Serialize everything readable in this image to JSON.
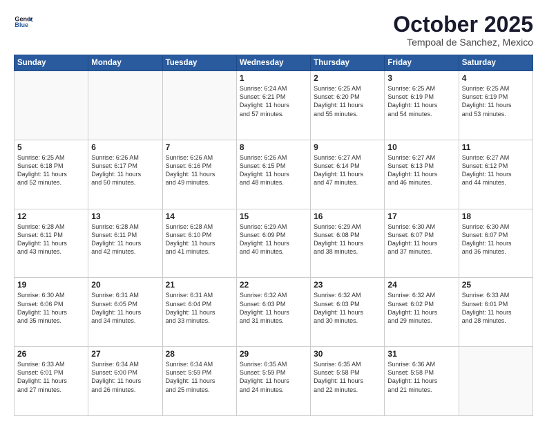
{
  "logo": {
    "line1": "General",
    "line2": "Blue"
  },
  "title": "October 2025",
  "subtitle": "Tempoal de Sanchez, Mexico",
  "weekdays": [
    "Sunday",
    "Monday",
    "Tuesday",
    "Wednesday",
    "Thursday",
    "Friday",
    "Saturday"
  ],
  "weeks": [
    [
      {
        "day": "",
        "info": ""
      },
      {
        "day": "",
        "info": ""
      },
      {
        "day": "",
        "info": ""
      },
      {
        "day": "1",
        "info": "Sunrise: 6:24 AM\nSunset: 6:21 PM\nDaylight: 11 hours\nand 57 minutes."
      },
      {
        "day": "2",
        "info": "Sunrise: 6:25 AM\nSunset: 6:20 PM\nDaylight: 11 hours\nand 55 minutes."
      },
      {
        "day": "3",
        "info": "Sunrise: 6:25 AM\nSunset: 6:19 PM\nDaylight: 11 hours\nand 54 minutes."
      },
      {
        "day": "4",
        "info": "Sunrise: 6:25 AM\nSunset: 6:19 PM\nDaylight: 11 hours\nand 53 minutes."
      }
    ],
    [
      {
        "day": "5",
        "info": "Sunrise: 6:25 AM\nSunset: 6:18 PM\nDaylight: 11 hours\nand 52 minutes."
      },
      {
        "day": "6",
        "info": "Sunrise: 6:26 AM\nSunset: 6:17 PM\nDaylight: 11 hours\nand 50 minutes."
      },
      {
        "day": "7",
        "info": "Sunrise: 6:26 AM\nSunset: 6:16 PM\nDaylight: 11 hours\nand 49 minutes."
      },
      {
        "day": "8",
        "info": "Sunrise: 6:26 AM\nSunset: 6:15 PM\nDaylight: 11 hours\nand 48 minutes."
      },
      {
        "day": "9",
        "info": "Sunrise: 6:27 AM\nSunset: 6:14 PM\nDaylight: 11 hours\nand 47 minutes."
      },
      {
        "day": "10",
        "info": "Sunrise: 6:27 AM\nSunset: 6:13 PM\nDaylight: 11 hours\nand 46 minutes."
      },
      {
        "day": "11",
        "info": "Sunrise: 6:27 AM\nSunset: 6:12 PM\nDaylight: 11 hours\nand 44 minutes."
      }
    ],
    [
      {
        "day": "12",
        "info": "Sunrise: 6:28 AM\nSunset: 6:11 PM\nDaylight: 11 hours\nand 43 minutes."
      },
      {
        "day": "13",
        "info": "Sunrise: 6:28 AM\nSunset: 6:11 PM\nDaylight: 11 hours\nand 42 minutes."
      },
      {
        "day": "14",
        "info": "Sunrise: 6:28 AM\nSunset: 6:10 PM\nDaylight: 11 hours\nand 41 minutes."
      },
      {
        "day": "15",
        "info": "Sunrise: 6:29 AM\nSunset: 6:09 PM\nDaylight: 11 hours\nand 40 minutes."
      },
      {
        "day": "16",
        "info": "Sunrise: 6:29 AM\nSunset: 6:08 PM\nDaylight: 11 hours\nand 38 minutes."
      },
      {
        "day": "17",
        "info": "Sunrise: 6:30 AM\nSunset: 6:07 PM\nDaylight: 11 hours\nand 37 minutes."
      },
      {
        "day": "18",
        "info": "Sunrise: 6:30 AM\nSunset: 6:07 PM\nDaylight: 11 hours\nand 36 minutes."
      }
    ],
    [
      {
        "day": "19",
        "info": "Sunrise: 6:30 AM\nSunset: 6:06 PM\nDaylight: 11 hours\nand 35 minutes."
      },
      {
        "day": "20",
        "info": "Sunrise: 6:31 AM\nSunset: 6:05 PM\nDaylight: 11 hours\nand 34 minutes."
      },
      {
        "day": "21",
        "info": "Sunrise: 6:31 AM\nSunset: 6:04 PM\nDaylight: 11 hours\nand 33 minutes."
      },
      {
        "day": "22",
        "info": "Sunrise: 6:32 AM\nSunset: 6:03 PM\nDaylight: 11 hours\nand 31 minutes."
      },
      {
        "day": "23",
        "info": "Sunrise: 6:32 AM\nSunset: 6:03 PM\nDaylight: 11 hours\nand 30 minutes."
      },
      {
        "day": "24",
        "info": "Sunrise: 6:32 AM\nSunset: 6:02 PM\nDaylight: 11 hours\nand 29 minutes."
      },
      {
        "day": "25",
        "info": "Sunrise: 6:33 AM\nSunset: 6:01 PM\nDaylight: 11 hours\nand 28 minutes."
      }
    ],
    [
      {
        "day": "26",
        "info": "Sunrise: 6:33 AM\nSunset: 6:01 PM\nDaylight: 11 hours\nand 27 minutes."
      },
      {
        "day": "27",
        "info": "Sunrise: 6:34 AM\nSunset: 6:00 PM\nDaylight: 11 hours\nand 26 minutes."
      },
      {
        "day": "28",
        "info": "Sunrise: 6:34 AM\nSunset: 5:59 PM\nDaylight: 11 hours\nand 25 minutes."
      },
      {
        "day": "29",
        "info": "Sunrise: 6:35 AM\nSunset: 5:59 PM\nDaylight: 11 hours\nand 24 minutes."
      },
      {
        "day": "30",
        "info": "Sunrise: 6:35 AM\nSunset: 5:58 PM\nDaylight: 11 hours\nand 22 minutes."
      },
      {
        "day": "31",
        "info": "Sunrise: 6:36 AM\nSunset: 5:58 PM\nDaylight: 11 hours\nand 21 minutes."
      },
      {
        "day": "",
        "info": ""
      }
    ]
  ]
}
